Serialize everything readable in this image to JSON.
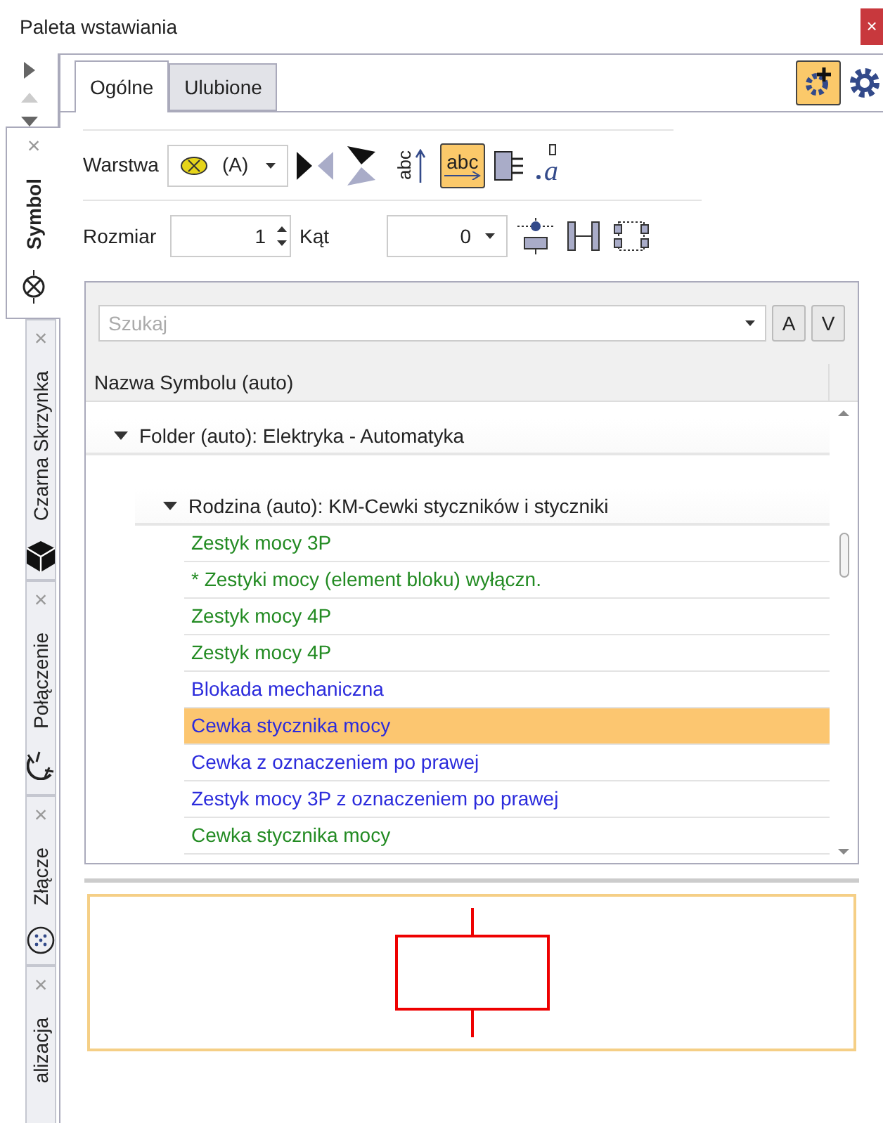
{
  "window": {
    "title": "Paleta wstawiania",
    "close": "×"
  },
  "side_tabs": [
    {
      "label": "Symbol",
      "close": "×",
      "selected": true
    },
    {
      "label": "Czarna Skrzynka",
      "close": "×",
      "selected": false
    },
    {
      "label": "Połączenie",
      "close": "×",
      "selected": false
    },
    {
      "label": "Złącze",
      "close": "×",
      "selected": false
    },
    {
      "label": "alizacja",
      "close": "×",
      "selected": false
    }
  ],
  "tabs": [
    {
      "label": "Ogólne",
      "selected": true
    },
    {
      "label": "Ulubione",
      "selected": false
    }
  ],
  "toolbar": {
    "layer_label": "Warstwa",
    "layer_value": "(A)",
    "size_label": "Rozmiar",
    "size_value": "1",
    "angle_label": "Kąt",
    "angle_value": "0",
    "vertical_text_button": "abc",
    "horizontal_text_button": "abc",
    "text_style_button": "a",
    "text_horizontal_on": true
  },
  "search": {
    "placeholder": "Szukaj",
    "button_a": "A",
    "button_v": "V"
  },
  "table": {
    "column": "Nazwa Symbolu (auto)",
    "folder": {
      "label": "Folder (auto): Elektryka - Automatyka",
      "expanded": true
    },
    "family": {
      "label": "Rodzina (auto): KM-Cewki styczników i styczniki",
      "expanded": true
    },
    "rows": [
      {
        "label": "Zestyk mocy 3P",
        "color": "#238b23",
        "selected": false
      },
      {
        "label": "* Zestyki mocy (element bloku) wyłączn.",
        "color": "#238b23",
        "selected": false
      },
      {
        "label": "Zestyk mocy 4P",
        "color": "#238b23",
        "selected": false
      },
      {
        "label": "Zestyk mocy 4P",
        "color": "#238b23",
        "selected": false
      },
      {
        "label": "Blokada mechaniczna",
        "color": "#2b2bdc",
        "selected": false
      },
      {
        "label": "Cewka stycznika mocy",
        "color": "#2b2bdc",
        "selected": true
      },
      {
        "label": "Cewka z oznaczeniem po prawej",
        "color": "#2b2bdc",
        "selected": false
      },
      {
        "label": "Zestyk mocy 3P z oznaczeniem po prawej",
        "color": "#2b2bdc",
        "selected": false
      },
      {
        "label": "Cewka stycznika mocy",
        "color": "#238b23",
        "selected": false
      }
    ]
  }
}
